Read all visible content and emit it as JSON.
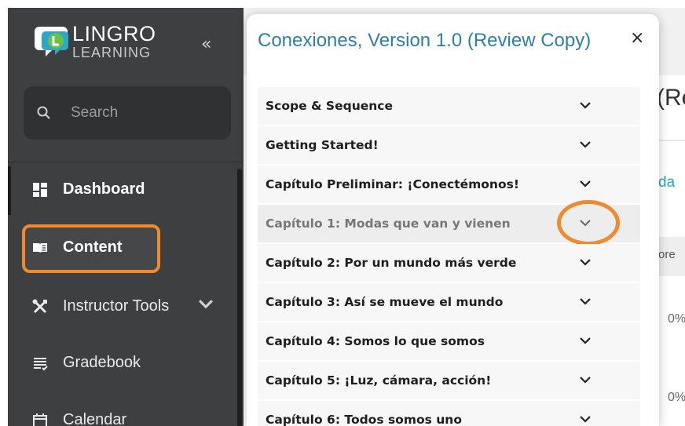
{
  "brand": {
    "name_top": "LINGRO",
    "name_bottom": "LEARNING",
    "icon": "lingro-logo-icon",
    "accent": "#ef8b2c"
  },
  "sidebar": {
    "collapse_glyph": "«",
    "search": {
      "placeholder": "Search"
    },
    "items": [
      {
        "label": "Dashboard",
        "icon": "dashboard-icon"
      },
      {
        "label": "Content",
        "icon": "book-icon"
      },
      {
        "label": "Instructor Tools",
        "icon": "tools-icon"
      },
      {
        "label": "Gradebook",
        "icon": "gradebook-icon"
      },
      {
        "label": "Calendar",
        "icon": "calendar-icon"
      }
    ]
  },
  "drawer": {
    "title": "Conexiones, Version 1.0 (Review Copy)",
    "close_glyph": "×",
    "chapters": [
      {
        "label": "Scope & Sequence"
      },
      {
        "label": "Getting Started!"
      },
      {
        "label": "Capítulo Preliminar: ¡Conectémonos!"
      },
      {
        "label": "Capítulo 1: Modas que van y vienen"
      },
      {
        "label": "Capítulo 2: Por un mundo más verde"
      },
      {
        "label": "Capítulo 3: Así se mueve el mundo"
      },
      {
        "label": "Capítulo 4: Somos lo que somos"
      },
      {
        "label": "Capítulo 5: ¡Luz, cámara, acción!"
      },
      {
        "label": "Capítulo 6: Todos somos uno"
      }
    ]
  },
  "background": {
    "title_fragment": "(Re",
    "tab_fragment": "da",
    "column_fragment": "ore",
    "values": [
      "0%",
      "0%"
    ]
  }
}
